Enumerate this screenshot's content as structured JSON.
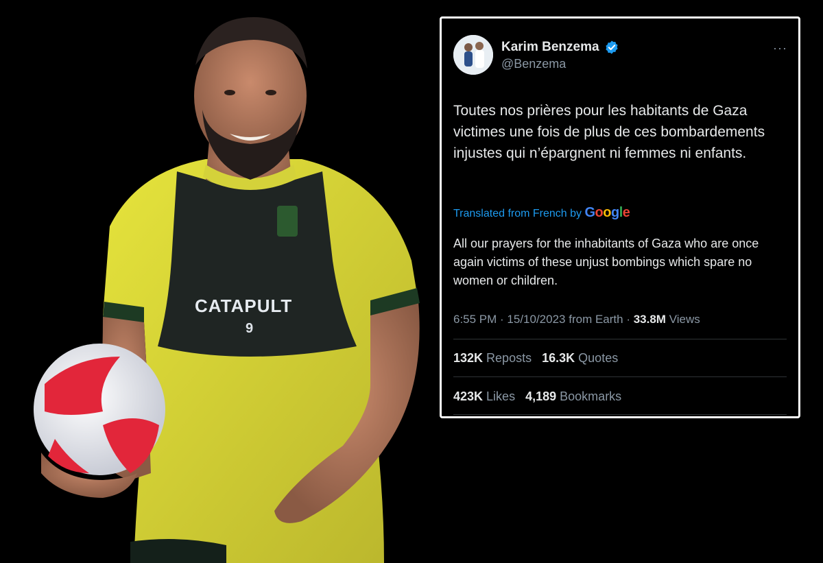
{
  "tweet": {
    "author_name": "Karim Benzema",
    "author_handle": "@Benzema",
    "more_label": "···",
    "text": "Toutes nos prières pour les habitants de Gaza victimes une fois de plus de ces bombardements injustes qui n’épargnent ni femmes ni enfants.",
    "translated_prefix": "Translated from French by",
    "translator": "Google",
    "translation": "All our prayers for the inhabitants of Gaza who are once again victims of these unjust bombings which spare no women or children.",
    "time": "6:55 PM",
    "date": "15/10/2023",
    "source": "from Earth",
    "views_count": "33.8M",
    "views_label": "Views",
    "reposts_count": "132K",
    "reposts_label": "Reposts",
    "quotes_count": "16.3K",
    "quotes_label": "Quotes",
    "likes_count": "423K",
    "likes_label": "Likes",
    "bookmarks_count": "4,189",
    "bookmarks_label": "Bookmarks"
  },
  "photo": {
    "bib_brand": "CATAPULT",
    "bib_number": "9"
  },
  "colors": {
    "accent": "#1d9bf0",
    "jersey": "#e3e23a",
    "bib": "#1f2523",
    "background": "#000000"
  },
  "icons": {
    "verified": "verified-badge-icon",
    "more": "more-horizontal-icon"
  }
}
